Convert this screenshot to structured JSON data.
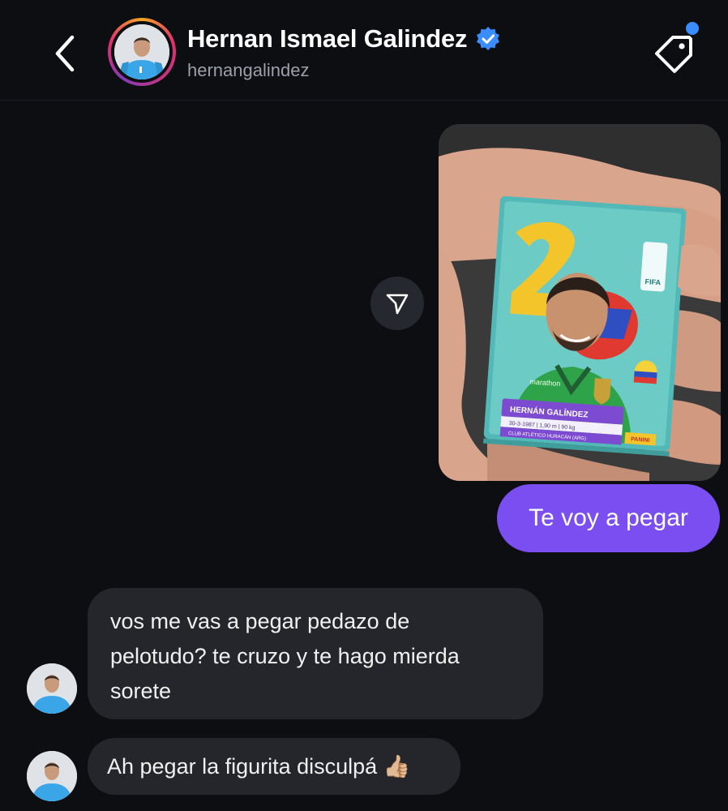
{
  "header": {
    "contact_name": "Hernan Ismael Galindez",
    "username": "hernangalindez",
    "verified_icon": "verified-badge-icon",
    "back_icon": "chevron-left-icon",
    "tag_icon": "tag-icon"
  },
  "messages": [
    {
      "direction": "outgoing",
      "type": "image",
      "image": {
        "sticker_name": "HERNÁN GALÍNDEZ",
        "sticker_info": "30-3-1987 | 1,90 m | 90 kg",
        "sticker_club": "CLUB ATLÉTICO HURACÁN (ARG)",
        "sticker_kit_sponsor": "marathon",
        "sticker_brand": "PANINI",
        "sticker_logo_text": "FIFA"
      }
    },
    {
      "direction": "outgoing",
      "type": "text",
      "text": "Te voy a pegar"
    },
    {
      "direction": "incoming",
      "type": "text",
      "lines": [
        "vos me vas a pegar pedazo de",
        "pelotudo? te cruzo y te hago mierda",
        "sorete"
      ]
    },
    {
      "direction": "incoming",
      "type": "text",
      "text": "Ah pegar la figurita disculpá 👍🏼"
    }
  ],
  "colors": {
    "background": "#0c0e12",
    "outgoing_bubble": "#7a4ef0",
    "incoming_bubble": "#24262c",
    "verified": "#3b8cff",
    "notification_dot": "#3b8cff"
  }
}
